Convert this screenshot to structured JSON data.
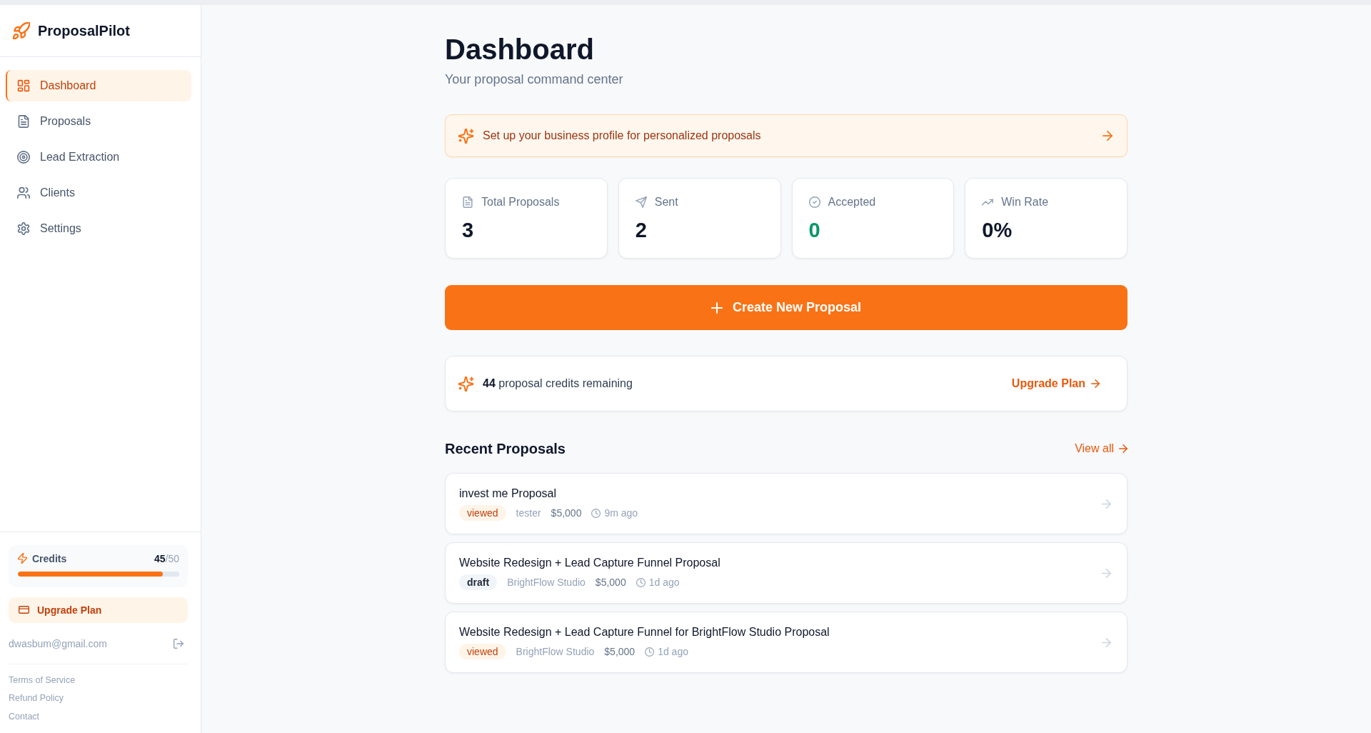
{
  "sidebar": {
    "brand": "ProposalPilot",
    "nav": [
      {
        "label": "Dashboard",
        "selected": true
      },
      {
        "label": "Proposals",
        "selected": false
      },
      {
        "label": "Lead Extraction",
        "selected": false
      },
      {
        "label": "Clients",
        "selected": false
      },
      {
        "label": "Settings",
        "selected": false
      }
    ],
    "credits": {
      "label": "Credits",
      "count": "**45**/50",
      "level": 0.9
    },
    "upgrade_button": "Upgrade Plan",
    "email": "dwasbum@gmail.com",
    "footer_links": [
      "Terms of Service",
      "Refund Policy",
      "Contact"
    ]
  },
  "header": {
    "title": "Dashboard",
    "subtitle": "Your proposal command center"
  },
  "profile_banner": {
    "text": "Set up your business profile for personalized proposals"
  },
  "stats": [
    {
      "label": "Total Proposals",
      "value": "3",
      "color": "#0f172a"
    },
    {
      "label": "Sent",
      "value": "2",
      "color": "#0f172a"
    },
    {
      "label": "Accepted",
      "value": "0",
      "color": "#059669"
    },
    {
      "label": "Win Rate",
      "value": "0%",
      "color": "#0f172a"
    }
  ],
  "create_button": "Create New Proposal",
  "credits_notice": {
    "text": "**44** proposal credits remaining",
    "link": "Upgrade Plan"
  },
  "recent": {
    "title": "Recent Proposals",
    "view_all": "View all",
    "items": [
      {
        "title": "invest me Proposal",
        "status": {
          "label": "viewed",
          "kind": "viewed"
        },
        "client": "tester",
        "amount": "$5,000",
        "time": "9m ago"
      },
      {
        "title": "Website Redesign + Lead Capture Funnel Proposal",
        "status": {
          "label": "draft",
          "kind": "draft"
        },
        "client": "BrightFlow Studio",
        "amount": "$5,000",
        "time": "1d ago"
      },
      {
        "title": "Website Redesign + Lead Capture Funnel for BrightFlow Studio Proposal",
        "status": {
          "label": "viewed",
          "kind": "viewed"
        },
        "client": "BrightFlow Studio",
        "amount": "$5,000",
        "time": "1d ago"
      }
    ]
  }
}
